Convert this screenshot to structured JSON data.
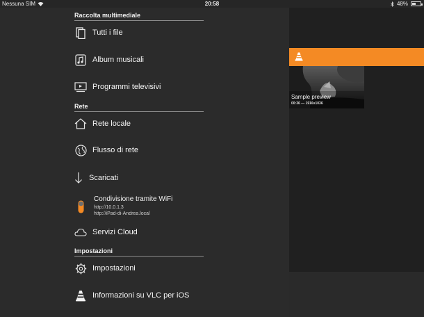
{
  "status_bar": {
    "carrier": "Nessuna SIM",
    "time": "20:58",
    "battery": "48%",
    "battery_level": 0.48
  },
  "sidebar": {
    "media_section": "Raccolta multimediale",
    "all_files": "Tutti i file",
    "music_albums": "Album musicali",
    "tv_shows": "Programmi televisivi",
    "network_section": "Rete",
    "local_network": "Rete locale",
    "network_stream": "Flusso di rete",
    "downloads": "Scaricati",
    "wifi_sharing": {
      "label": "Condivisione tramite WiFi",
      "url1": "http://10.0.1.3",
      "url2": "http://iPad-di-Andrea.local"
    },
    "cloud_services": "Servizi Cloud",
    "settings_section": "Impostazioni",
    "settings": "Impostazioni",
    "about": "Informazioni su VLC per iOS"
  },
  "main": {
    "video": {
      "title": "Sample preview",
      "meta": "00:36 — 1916x1036"
    }
  },
  "colors": {
    "accent": "#f48a24",
    "background": "#2b2b2b"
  },
  "icons": {
    "files": "document-icon",
    "music": "music-note-icon",
    "tv": "tv-icon",
    "local_network": "home-icon",
    "stream": "globe-icon",
    "downloads": "download-arrow-icon",
    "wifi": "toggle-icon",
    "cloud": "cloud-icon",
    "settings": "gear-icon",
    "about": "vlc-cone-icon"
  }
}
